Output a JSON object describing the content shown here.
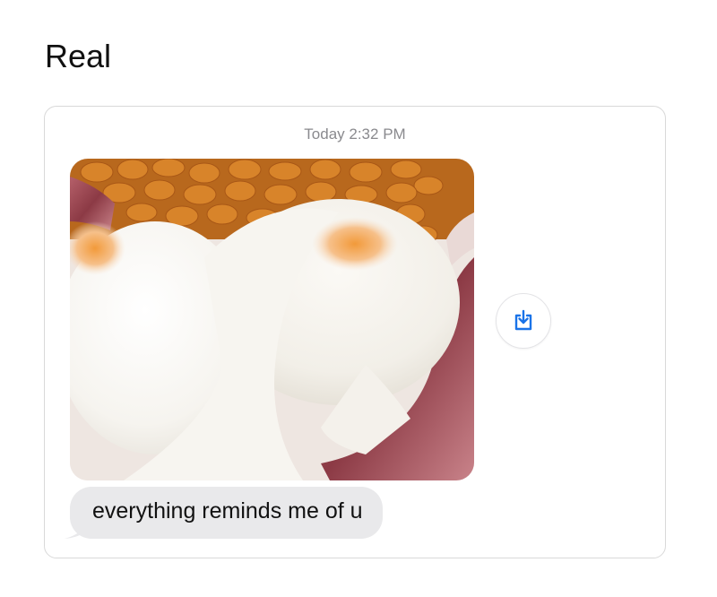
{
  "post": {
    "title": "Real"
  },
  "conversation": {
    "timestamp": "Today 2:32 PM",
    "photo": {
      "content": "food-photo-eggs-beans-bacon"
    },
    "save_button": {
      "icon": "download-tray-icon",
      "color": "#1a73e8"
    },
    "message": {
      "text": "everything reminds me of u",
      "bubble_color": "#e9e9eb"
    }
  }
}
